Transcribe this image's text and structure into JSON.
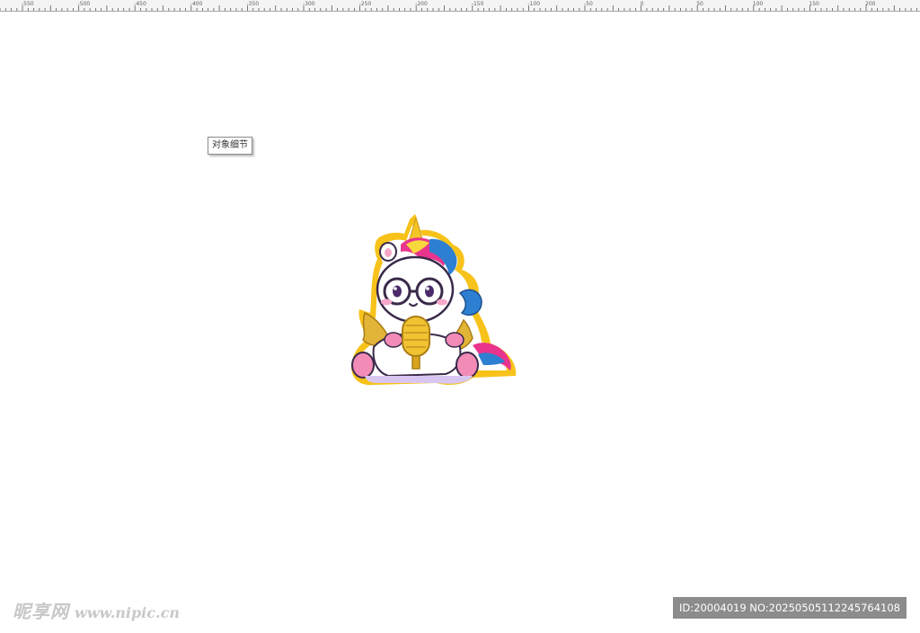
{
  "ruler": {
    "tick_labels": [
      "-550",
      "-500",
      "-450",
      "-400",
      "-350",
      "-300",
      "-250",
      "-200",
      "-150",
      "-100",
      "-50",
      "0",
      "50",
      "100",
      "150",
      "200",
      "250"
    ]
  },
  "tooltip": {
    "text": "对象细节"
  },
  "artwork": {
    "subject": "unicorn-with-microphone-sticker",
    "colors": {
      "outline": "#f7c21a",
      "horn": "#f6c526",
      "mane_pink": "#e9348d",
      "mane_blue": "#2d7fd1",
      "mane_yellow": "#f8d63e",
      "body": "#ffffff",
      "cheek": "#f7a8c8",
      "wing": "#e2b437",
      "microphone": "#f1c232",
      "hoof": "#f28bb6"
    }
  },
  "watermark": {
    "brand": "昵享网",
    "url": "www.nipic.cn"
  },
  "id_bar": {
    "text": "ID:20004019 NO:20250505112245764108"
  }
}
